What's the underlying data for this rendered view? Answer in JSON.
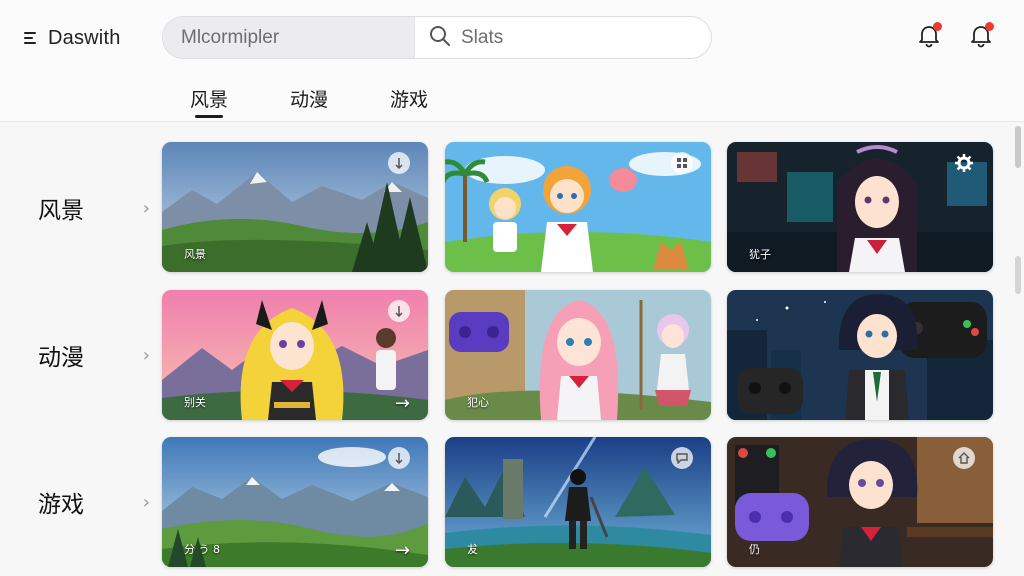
{
  "header": {
    "brand": "Daswith",
    "search_scope": "Mlcormipler",
    "search_placeholder": "Slats",
    "notifications": [
      {
        "name": "notifications",
        "has_badge": true
      },
      {
        "name": "alerts",
        "has_badge": true
      }
    ],
    "accent_color": "#ec3a2e"
  },
  "tabs": [
    {
      "label": "风景",
      "active": true
    },
    {
      "label": "动漫",
      "active": false
    },
    {
      "label": "游戏",
      "active": false
    }
  ],
  "rows": [
    {
      "label": "风景",
      "cards": [
        {
          "caption": "风景",
          "badge_icon": "sort-icon"
        },
        {
          "caption": "",
          "badge_icon": "grid-icon"
        },
        {
          "caption": "犹子",
          "badge_icon": "gear-icon"
        }
      ]
    },
    {
      "label": "动漫",
      "cards": [
        {
          "caption": "别关",
          "badge_icon": "sort-icon",
          "arrow": "→"
        },
        {
          "caption": "犯心",
          "badge_icon": ""
        },
        {
          "caption": "",
          "badge_icon": ""
        }
      ]
    },
    {
      "label": "游戏",
      "cards": [
        {
          "caption": "分 う 8",
          "badge_icon": "sort-icon",
          "arrow": "→"
        },
        {
          "caption": "犮",
          "badge_icon": "message-icon"
        },
        {
          "caption": "仍",
          "badge_icon": "home-icon"
        }
      ]
    }
  ]
}
